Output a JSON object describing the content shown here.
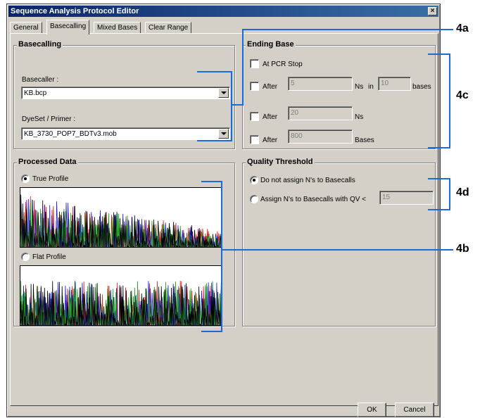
{
  "window": {
    "title": "Sequence Analysis Protocol Editor",
    "close_label": "×"
  },
  "tabs": [
    {
      "label": "General",
      "active": false
    },
    {
      "label": "Basecalling",
      "active": true
    },
    {
      "label": "Mixed Bases",
      "active": false
    },
    {
      "label": "Clear Range",
      "active": false
    }
  ],
  "basecalling": {
    "title": "Basecalling",
    "basecaller_label": "Basecaller :",
    "basecaller_value": "KB.bcp",
    "dyeset_label": "DyeSet / Primer :",
    "dyeset_value": "KB_3730_POP7_BDTv3.mob"
  },
  "ending_base": {
    "title": "Ending Base",
    "at_pcr_stop": "At PCR Stop",
    "after_label": "After",
    "row2_value": "5",
    "row2_ns": "Ns",
    "row2_in": "in",
    "row2_value2": "10",
    "row2_bases": "bases",
    "row3_value": "20",
    "row3_ns": "Ns",
    "row4_value": "800",
    "row4_bases": "Bases"
  },
  "processed_data": {
    "title": "Processed Data",
    "true_profile": "True Profile",
    "flat_profile": "Flat Profile",
    "selected": "True Profile"
  },
  "quality_threshold": {
    "title": "Quality Threshold",
    "option1": "Do not assign N's to Basecalls",
    "option2": "Assign N's to Basecalls with QV <",
    "qv_value": "15",
    "selected": "Do not assign N's to Basecalls"
  },
  "buttons": {
    "ok": "OK",
    "cancel": "Cancel"
  },
  "callouts": {
    "a": "4a",
    "b": "4b",
    "c": "4c",
    "d": "4d"
  },
  "colors": {
    "callout_line": "#1a6bd6",
    "title_bar": "#0a246a",
    "trace_red": "#e01818",
    "trace_blue": "#1818d0",
    "trace_green": "#18a018",
    "trace_black": "#000000"
  }
}
